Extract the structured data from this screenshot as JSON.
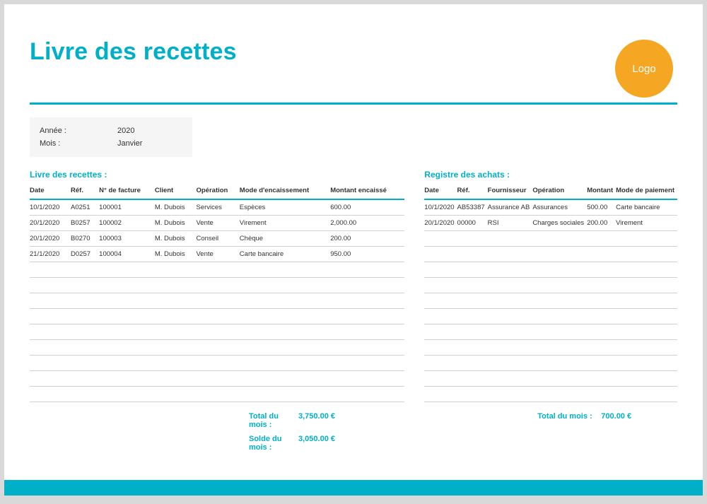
{
  "title": "Livre des recettes",
  "logo_text": "Logo",
  "meta": {
    "year_label": "Année :",
    "year_value": "2020",
    "month_label": "Mois :",
    "month_value": "Janvier"
  },
  "recettes": {
    "section_title": "Livre des recettes :",
    "headers": [
      "Date",
      "Réf.",
      "N° de facture",
      "Client",
      "Opération",
      "Mode d'encaissement",
      "Montant encaissé"
    ],
    "rows": [
      [
        "10/1/2020",
        "A0251",
        "100001",
        "M. Dubois",
        "Services",
        "Espèces",
        "600.00"
      ],
      [
        "20/1/2020",
        "B0257",
        "100002",
        "M. Dubois",
        "Vente",
        "Virement",
        "2,000.00"
      ],
      [
        "20/1/2020",
        "B0270",
        "100003",
        "M. Dubois",
        "Conseil",
        "Chèque",
        "200.00"
      ],
      [
        "21/1/2020",
        "D0257",
        "100004",
        "M. Dubois",
        "Vente",
        "Carte bancaire",
        "950.00"
      ]
    ],
    "empty_rows": 9,
    "totals": [
      {
        "label": "Total du mois :",
        "value": "3,750.00 €"
      },
      {
        "label": "Solde du mois :",
        "value": "3,050.00 €"
      }
    ]
  },
  "achats": {
    "section_title": "Registre des achats :",
    "headers": [
      "Date",
      "Réf.",
      "Fournisseur",
      "Opération",
      "Montant",
      "Mode de paiement"
    ],
    "rows": [
      [
        "10/1/2020",
        "AB53387",
        "Assurance AB",
        "Assurances",
        "500.00",
        "Carte bancaire"
      ],
      [
        "20/1/2020",
        "00000",
        "RSI",
        "Charges sociales",
        "200.00",
        "Virement"
      ]
    ],
    "empty_rows": 11,
    "totals": [
      {
        "label": "Total du mois :",
        "value": "700.00 €"
      }
    ]
  }
}
